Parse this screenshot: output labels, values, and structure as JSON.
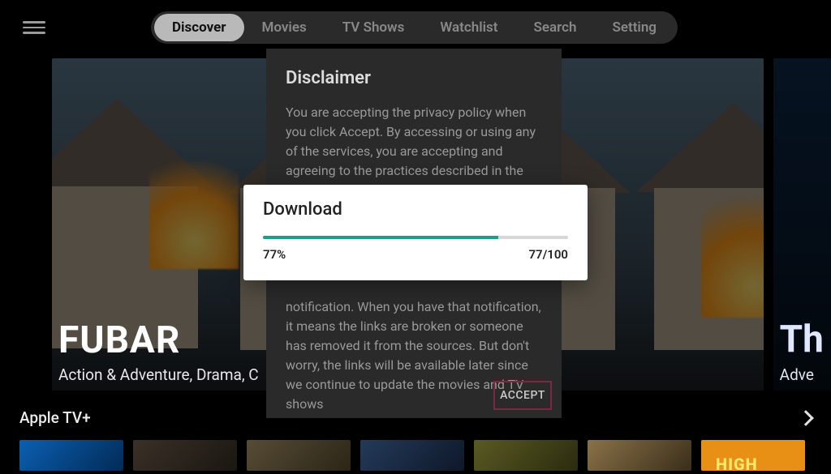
{
  "header": {
    "tabs": [
      "Discover",
      "Movies",
      "TV Shows",
      "Watchlist",
      "Search",
      "Setting"
    ],
    "active_tab": 0
  },
  "hero": {
    "main": {
      "title": "FUBAR",
      "subtitle": "Action & Adventure, Drama, C"
    },
    "side": {
      "title": "Th",
      "subtitle": "Adve"
    }
  },
  "section": {
    "title": "Apple TV+",
    "thumb_label": "HIGH"
  },
  "disclaimer": {
    "title": "Disclaimer",
    "body_top": "You are accepting the privacy policy when you click Accept. By accessing or using any of the services, you are accepting and agreeing to the practices described in the Privacy",
    "body_bottom": "notification. When you have that notification, it means the links are broken or someone has removed it from the sources. But don't worry, the links will be available later since we continue to update the movies and TV shows",
    "accept_label": "ACCEPT"
  },
  "download": {
    "title": "Download",
    "percent_value": 77,
    "percent_label": "77%",
    "fraction": "77/100"
  }
}
